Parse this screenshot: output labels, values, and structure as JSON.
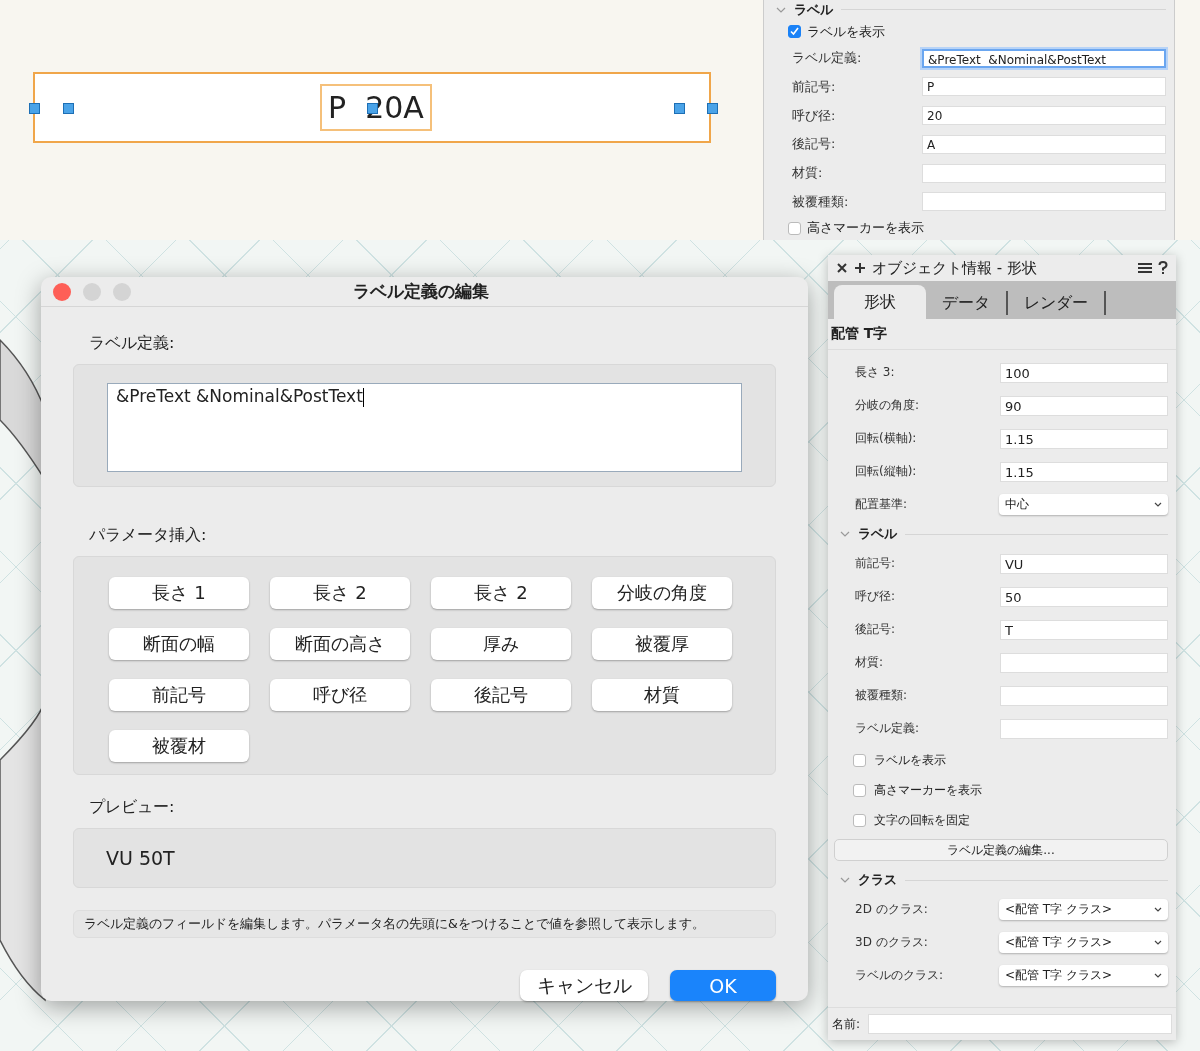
{
  "canvas_label": {
    "text": "P  20A"
  },
  "top_panel": {
    "section": "ラベル",
    "items": [
      {
        "kind": "checkbox",
        "label": "ラベルを表示",
        "checked": true
      },
      {
        "kind": "field",
        "label": "ラベル定義:",
        "value": "&PreText  &Nominal&PostText",
        "focused": true
      },
      {
        "kind": "field",
        "label": "前記号:",
        "value": "P",
        "focused": false
      },
      {
        "kind": "field",
        "label": "呼び径:",
        "value": "20",
        "focused": false
      },
      {
        "kind": "field",
        "label": "後記号:",
        "value": "A",
        "focused": false
      },
      {
        "kind": "field",
        "label": "材質:",
        "focused": false
      },
      {
        "kind": "field",
        "label": "被覆種類:",
        "focused": false
      },
      {
        "kind": "checkbox",
        "label": "高さマーカーを表示",
        "checked": false
      }
    ]
  },
  "dialog": {
    "title": "ラベル定義の編集",
    "definition_label": "ラベル定義:",
    "definition_value": "&PreText &Nominal&PostText",
    "parameters_label": "パラメータ挿入:",
    "parameter_buttons": [
      "長さ 1",
      "長さ 2",
      "長さ 2",
      "分岐の角度",
      "断面の幅",
      "断面の高さ",
      "厚み",
      "被覆厚",
      "前記号",
      "呼び径",
      "後記号",
      "材質",
      "被覆材"
    ],
    "preview_label": "プレビュー:",
    "preview": "VU 50T",
    "help": "ラベル定義のフィールドを編集します。パラメータ名の先頭に&をつけることで値を参照して表示します。",
    "buttons": [
      {
        "label": "キャンセル",
        "primary": false
      },
      {
        "label": "OK",
        "primary": true
      }
    ]
  },
  "object_info": {
    "title": "オブジェクト情報 - 形状",
    "tabs": [
      {
        "label": "形状",
        "selected": true
      },
      {
        "label": "データ",
        "selected": false
      },
      {
        "label": "レンダー",
        "selected": false
      }
    ],
    "object_type": "配管 T字",
    "items": [
      {
        "kind": "field",
        "label": "長さ 3:",
        "value": "100"
      },
      {
        "kind": "field",
        "label": "分岐の角度:",
        "value": "90"
      },
      {
        "kind": "field",
        "label": "回転(横軸):",
        "value": "1.15"
      },
      {
        "kind": "field",
        "label": "回転(縦軸):",
        "value": "1.15"
      },
      {
        "kind": "select",
        "label": "配置基準:",
        "value": "中心"
      },
      {
        "kind": "section",
        "label": "ラベル"
      },
      {
        "kind": "field",
        "label": "前記号:",
        "value": "VU"
      },
      {
        "kind": "field",
        "label": "呼び径:",
        "value": "50"
      },
      {
        "kind": "field",
        "label": "後記号:",
        "value": "T"
      },
      {
        "kind": "field",
        "label": "材質:"
      },
      {
        "kind": "field",
        "label": "被覆種類:"
      },
      {
        "kind": "field",
        "label": "ラベル定義:"
      },
      {
        "kind": "checkbox",
        "label": "ラベルを表示",
        "checked": false
      },
      {
        "kind": "checkbox",
        "label": "高さマーカーを表示",
        "checked": false
      },
      {
        "kind": "checkbox",
        "label": "文字の回転を固定",
        "checked": false
      },
      {
        "kind": "button",
        "label": "ラベル定義の編集..."
      },
      {
        "kind": "section",
        "label": "クラス"
      },
      {
        "kind": "select",
        "label": "2D のクラス:",
        "value": "<配管 T字 クラス>"
      },
      {
        "kind": "select",
        "label": "3D のクラス:",
        "value": "<配管 T字 クラス>"
      },
      {
        "kind": "select",
        "label": "ラベルのクラス:",
        "value": "<配管 T字 クラス>"
      }
    ],
    "name_label": "名前:"
  }
}
